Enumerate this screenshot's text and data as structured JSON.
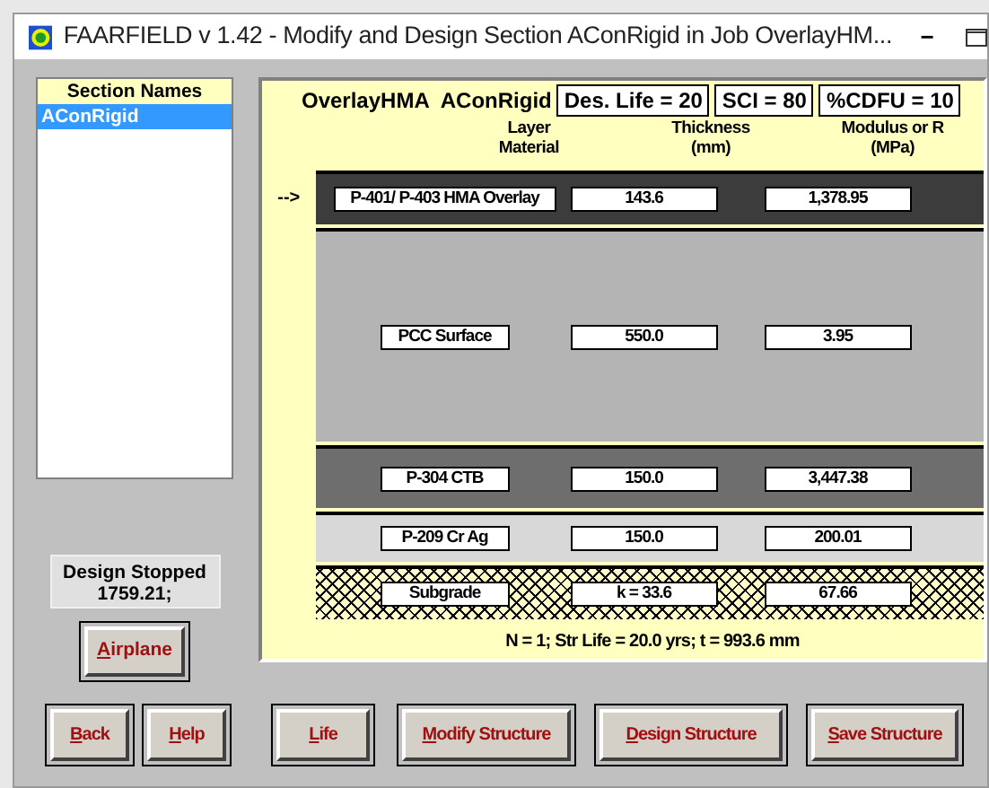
{
  "window": {
    "title": "FAARFIELD v 1.42 - Modify and Design Section AConRigid in Job OverlayHM...",
    "minimize": "−"
  },
  "section_list": {
    "heading": "Section Names",
    "items": [
      {
        "label": "AConRigid",
        "selected": true
      }
    ]
  },
  "status": {
    "lines": [
      "Design Stopped",
      "1759.21;"
    ]
  },
  "header": {
    "job": "OverlayHMA",
    "section": "AConRigid",
    "fields": [
      "Des. Life = 20",
      "SCI = 80",
      "%CDFU = 10"
    ]
  },
  "columns": [
    [
      "Layer",
      "Material"
    ],
    [
      "Thickness",
      "(mm)"
    ],
    [
      "Modulus or R",
      "(MPa)"
    ]
  ],
  "selection_marker": "-->",
  "layers": [
    {
      "material": "P-401/ P-403 HMA Overlay",
      "thickness": "143.6",
      "modulus": "1,378.95",
      "kind": "solid",
      "color": "#3c3c3c",
      "selected": true
    },
    {
      "material": "PCC Surface",
      "thickness": "550.0",
      "modulus": "3.95",
      "kind": "solid",
      "color": "#b4b4b4",
      "selected": false
    },
    {
      "material": "P-304 CTB",
      "thickness": "150.0",
      "modulus": "3,447.38",
      "kind": "solid",
      "color": "#6e6e6e",
      "selected": false
    },
    {
      "material": "P-209 Cr Ag",
      "thickness": "150.0",
      "modulus": "200.01",
      "kind": "solid",
      "color": "#d8d8d8",
      "selected": false
    },
    {
      "material": "Subgrade",
      "thickness": "k = 33.6",
      "modulus": "67.66",
      "kind": "hatched",
      "color": "#fffcc8",
      "selected": false
    }
  ],
  "summary": "N = 1;  Str Life = 20.0 yrs;  t = 993.6 mm",
  "airplane_button": {
    "label": "Airplane"
  },
  "buttons": [
    {
      "label": "Back"
    },
    {
      "label": "Help"
    },
    {
      "label": "Life"
    },
    {
      "label": "Modify Structure"
    },
    {
      "label": "Design Structure"
    },
    {
      "label": "Save Structure"
    }
  ]
}
